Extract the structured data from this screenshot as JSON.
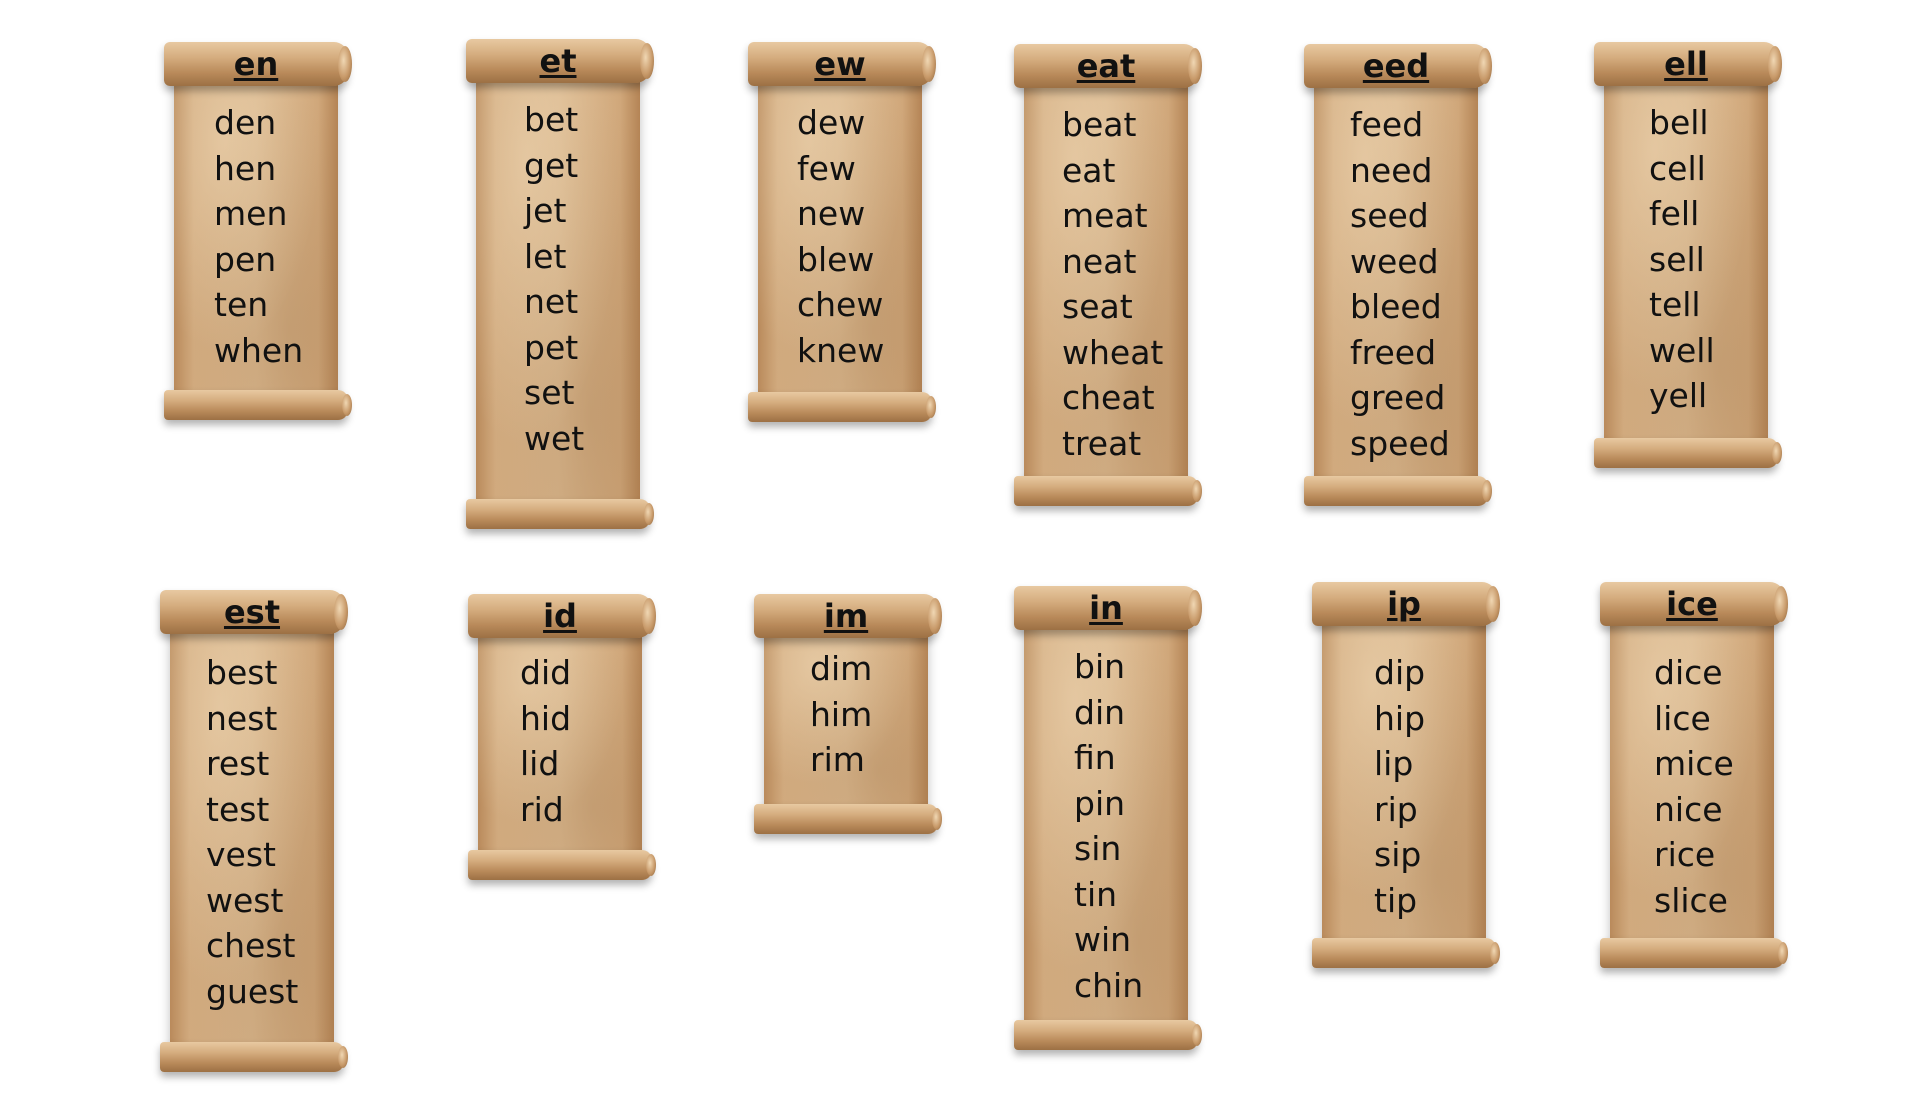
{
  "scrolls": [
    {
      "title": "en",
      "words": [
        "den",
        "hen",
        "men",
        "pen",
        "ten",
        "when"
      ]
    },
    {
      "title": "et",
      "words": [
        "bet",
        "get",
        "jet",
        "let",
        "net",
        "pet",
        "set",
        "wet"
      ]
    },
    {
      "title": "ew",
      "words": [
        "dew",
        "few",
        "new",
        "blew",
        "chew",
        "knew"
      ]
    },
    {
      "title": "eat",
      "words": [
        "beat",
        "eat",
        "meat",
        "neat",
        "seat",
        "wheat",
        "cheat",
        "treat"
      ]
    },
    {
      "title": "eed",
      "words": [
        "feed",
        "need",
        "seed",
        "weed",
        "bleed",
        "freed",
        "greed",
        "speed"
      ]
    },
    {
      "title": "ell",
      "words": [
        "bell",
        "cell",
        "fell",
        "sell",
        "tell",
        "well",
        "yell"
      ]
    },
    {
      "title": "est",
      "words": [
        "best",
        "nest",
        "rest",
        "test",
        "vest",
        "west",
        "chest",
        "guest"
      ]
    },
    {
      "title": "id",
      "words": [
        "did",
        "hid",
        "lid",
        "rid"
      ]
    },
    {
      "title": "im",
      "words": [
        "dim",
        "him",
        "rim"
      ]
    },
    {
      "title": "in",
      "words": [
        "bin",
        "din",
        "fin",
        "pin",
        "sin",
        "tin",
        "win",
        "chin"
      ]
    },
    {
      "title": "ip",
      "words": [
        "dip",
        "hip",
        "lip",
        "rip",
        "sip",
        "tip"
      ]
    },
    {
      "title": "ice",
      "words": [
        "dice",
        "lice",
        "mice",
        "nice",
        "rice",
        "slice"
      ]
    }
  ]
}
